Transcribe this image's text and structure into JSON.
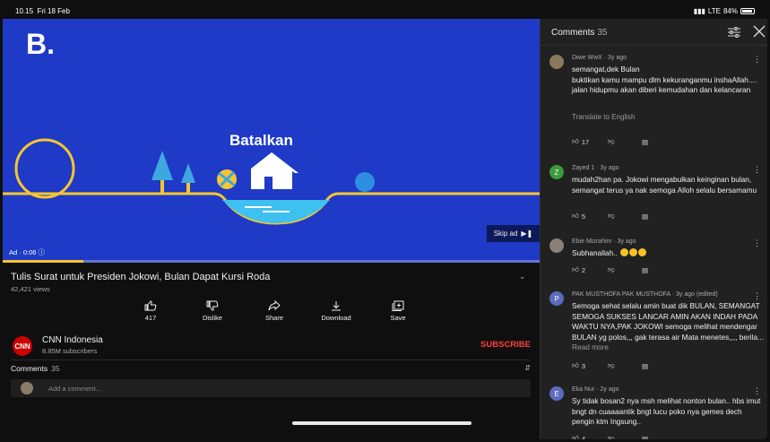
{
  "status_bar": {
    "time": "10.15",
    "date": "Fri 18 Feb",
    "network": "LTE",
    "battery": "84%"
  },
  "video": {
    "logo": "B.",
    "overlay_text": "Batalkan",
    "skip_ad": "Skip ad",
    "ad_label": "Ad · 0:06",
    "ad_progress": 0.15,
    "title": "Tulis Surat untuk Presiden Jokowi, Bulan Dapat Kursi Roda",
    "views": "42,421 views"
  },
  "actions": [
    {
      "icon": "thumbs-up-icon",
      "label": "417"
    },
    {
      "icon": "thumbs-down-icon",
      "label": "Dislike"
    },
    {
      "icon": "share-icon",
      "label": "Share"
    },
    {
      "icon": "download-icon",
      "label": "Download"
    },
    {
      "icon": "save-icon",
      "label": "Save"
    }
  ],
  "channel": {
    "logo_text": "CNN",
    "name": "CNN Indonesia",
    "subscribers": "8.85M subscribers",
    "subscribe_label": "SUBSCRIBE"
  },
  "comments_section": {
    "label": "Comments",
    "count": "35",
    "add_placeholder": "Add a comment..."
  },
  "panel": {
    "title": "Comments",
    "count": "35",
    "comments": [
      {
        "author": "Dwie WwX · 3y ago",
        "text": "semangat,dek Bulan\nbuktikan kamu mampu dlm kekuranganmu inshaAllah.... jalan hidupmu akan diberi kemudahan dan kelancaran",
        "translate": "Translate to English",
        "likes": "17",
        "avatar_letter": "",
        "avatar_color": "#8a7a5a"
      },
      {
        "author": "Zayed 1 · 3y ago",
        "text": "mudah2han pa. Jokowi mengabulkan keinginan bulan, semangat terus ya nak semoga Alloh selalu bersamamu",
        "likes": "5",
        "avatar_letter": "Z",
        "avatar_color": "#3b9b3b"
      },
      {
        "author": "Ebie Mizrahim · 3y ago",
        "text": "Subhanallah..",
        "likes": "2",
        "avatar_letter": "",
        "avatar_color": "#8a8078"
      },
      {
        "author": "PAK MUSTHOFA PAK MUSTHOFA · 3y ago (edited)",
        "text": "Semoga sehat selalu amin buat dik BULAN, SEMANGAT SEMOGA SUKSES LANCAR AMIN AKAN INDAH PADA WAKTU NYA,PAK JOKOWI semoga melihat mendengar BULAN yg polos,,, gak terasa air Mata menetes,,,, berila...",
        "read_more": "Read more",
        "likes": "3",
        "avatar_letter": "P",
        "avatar_color": "#5c6bc0"
      },
      {
        "author": "Eka Nur · 2y ago",
        "text": "Sy tidak bosan2 nya msh melihat nonton bulan.. hbs imut bngt dn cuaaaantik bngt lucu poko nya gemes dech pengin ktm Ingsung..",
        "likes": "4",
        "avatar_letter": "E",
        "avatar_color": "#5c6bc0"
      }
    ]
  }
}
